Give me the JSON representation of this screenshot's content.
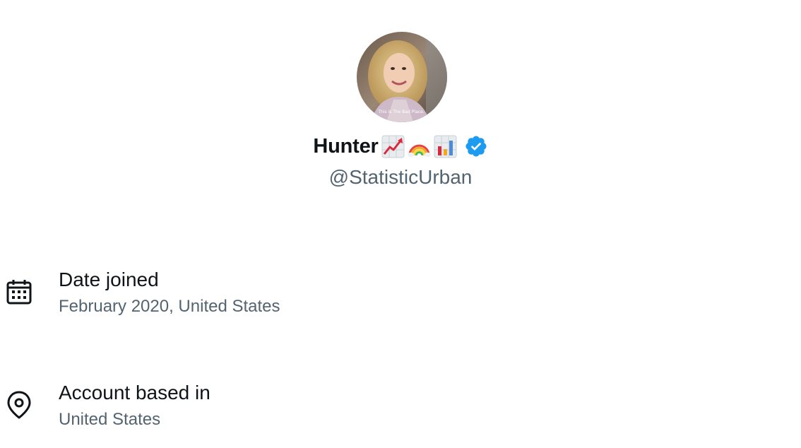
{
  "profile": {
    "avatar_caption": "This is The Bad Place.",
    "display_name": "Hunter",
    "name_emojis": [
      "chart-increasing-emoji",
      "rainbow-emoji",
      "bar-chart-emoji"
    ],
    "verified": true,
    "handle": "@StatisticUrban"
  },
  "about": {
    "date_joined": {
      "label": "Date joined",
      "value": "February 2020, United States",
      "icon": "calendar-icon"
    },
    "account_based_in": {
      "label": "Account based in",
      "value": "United States",
      "icon": "location-pin-icon"
    }
  },
  "colors": {
    "primary_text": "#0f1419",
    "secondary_text": "#536471",
    "verified_blue": "#1d9bf0"
  }
}
